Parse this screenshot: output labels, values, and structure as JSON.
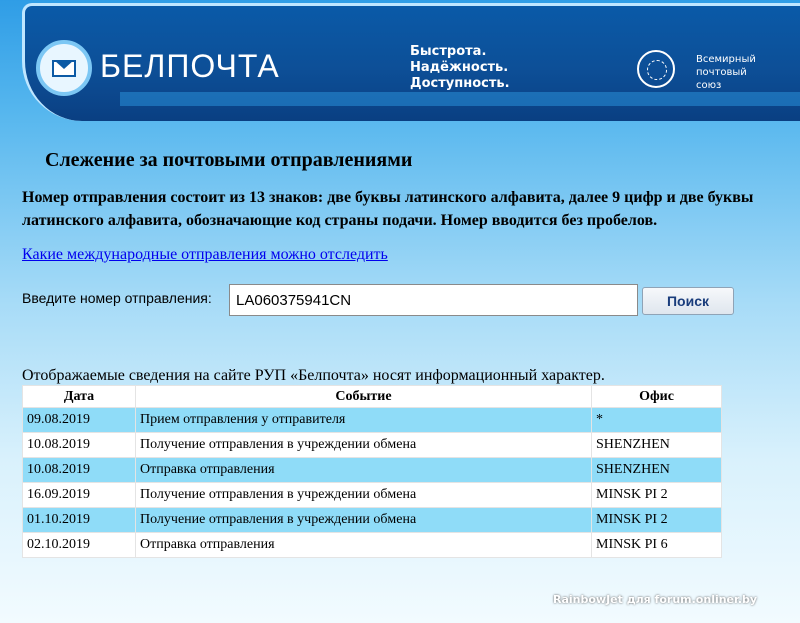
{
  "header": {
    "brand": "БЕЛПОЧТА",
    "slogan": [
      "Быстрота.",
      "Надёжность.",
      "Доступность."
    ],
    "upu": [
      "Всемирный",
      "почтовый",
      "союз"
    ],
    "logo_icon": "envelope-icon",
    "upu_icon": "globe-emblem-icon"
  },
  "page": {
    "title": "Слежение за почтовыми отправлениями",
    "info": "Номер отправления состоит из 13 знаков: две буквы латинского алфавита, далее 9 цифр и две буквы латинского алфавита, обозначающие код страны подачи. Номер вводится без пробелов.",
    "intl_link": "Какие международные отправления можно отследить"
  },
  "search": {
    "label": "Введите номер отправления:",
    "value": "LA060375941CN",
    "button": "Поиск"
  },
  "results": {
    "disclaimer": "Отображаемые сведения на сайте РУП «Белпочта» носят информационный характер.",
    "columns": [
      "Дата",
      "Событие",
      "Офис"
    ],
    "rows": [
      {
        "date": "09.08.2019",
        "event": "Прием отправления у отправителя",
        "office": "*"
      },
      {
        "date": "10.08.2019",
        "event": "Получение отправления в учреждении обмена",
        "office": "SHENZHEN"
      },
      {
        "date": "10.08.2019",
        "event": "Отправка отправления",
        "office": "SHENZHEN"
      },
      {
        "date": "16.09.2019",
        "event": "Получение отправления в учреждении обмена",
        "office": "MINSK PI 2"
      },
      {
        "date": "01.10.2019",
        "event": "Получение отправления в учреждении обмена",
        "office": "MINSK PI 2"
      },
      {
        "date": "02.10.2019",
        "event": "Отправка отправления",
        "office": "MINSK PI 6"
      }
    ],
    "row_colors": {
      "odd": "#8fdcf8",
      "even": "#ffffff"
    }
  },
  "watermark": "RainbowJet для forum.onliner.by",
  "colors": {
    "banner": "#0d4f97",
    "link": "#0000ee",
    "background_top": "#2f9de6"
  }
}
